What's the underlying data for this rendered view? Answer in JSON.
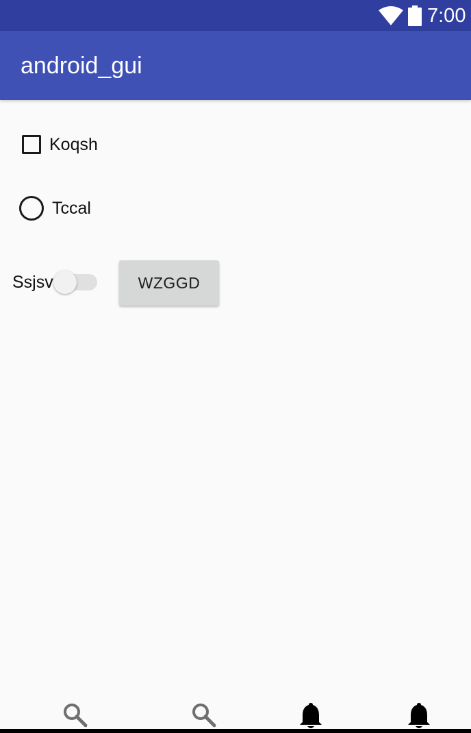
{
  "status_bar": {
    "time": "7:00",
    "icons": [
      "wifi-icon",
      "battery-icon"
    ],
    "color": "#303f9f"
  },
  "app_bar": {
    "title": "android_gui",
    "color": "#3f51b5"
  },
  "content": {
    "checkbox": {
      "label": "Koqsh",
      "checked": false
    },
    "radio": {
      "label": "Tccal",
      "selected": false
    },
    "switch": {
      "label": "Ssjsv",
      "on": false
    },
    "button": {
      "label": "WZGGD"
    }
  },
  "bottom_icons": [
    "search-icon",
    "search-icon",
    "bell-icon",
    "bell-icon"
  ]
}
